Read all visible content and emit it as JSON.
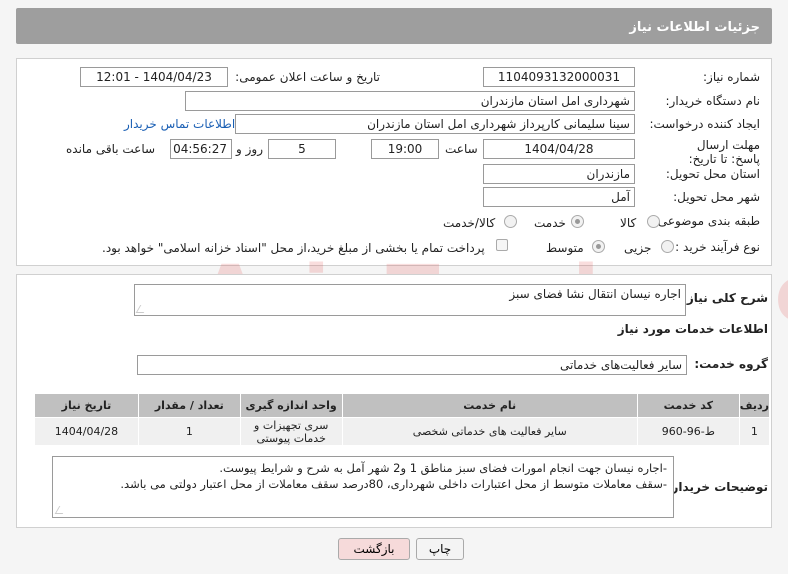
{
  "header": {
    "title": "جزئیات اطلاعات نیاز"
  },
  "watermark": {
    "brand": "AriaTender.neT"
  },
  "form": {
    "need_number": {
      "label": "شماره نیاز:",
      "value": "1104093132000031"
    },
    "announce": {
      "label": "تاریخ و ساعت اعلان عمومی:",
      "value": "1404/04/23 - 12:01"
    },
    "buyer_org": {
      "label": "نام دستگاه خریدار:",
      "value": "شهرداری امل استان مازندران"
    },
    "creator": {
      "label": "ایجاد کننده درخواست:",
      "value": "سینا سلیمانی کارپرداز شهرداری امل استان مازندران",
      "contact_link": "اطلاعات تماس خریدار"
    },
    "deadline": {
      "label": "مهلت ارسال پاسخ: تا تاریخ:",
      "date": "1404/04/28",
      "time_label": "ساعت",
      "time": "19:00",
      "days": "5",
      "days_label": "روز و",
      "remaining": "04:56:27",
      "remaining_label": "ساعت باقی مانده"
    },
    "province": {
      "label": "استان محل تحویل:",
      "value": "مازندران"
    },
    "city": {
      "label": "شهر محل تحویل:",
      "value": "آمل"
    },
    "category": {
      "label": "طبقه بندی موضوعی:",
      "options": [
        "کالا",
        "خدمت",
        "کالا/خدمت"
      ],
      "selected": "خدمت"
    },
    "purchase_type": {
      "label": "نوع فرآیند خرید :",
      "options": [
        "جزیی",
        "متوسط"
      ],
      "selected": "متوسط",
      "payment_note": "پرداخت تمام یا بخشی از مبلغ خرید،از محل \"اسناد خزانه اسلامی\" خواهد بود."
    }
  },
  "summary": {
    "label": "شرح کلی نیاز:",
    "value": "اجاره نیسان انتقال نشا فضای سبز"
  },
  "services": {
    "section_title": "اطلاعات خدمات مورد نیاز",
    "group_label": "گروه خدمت:",
    "group_value": "سایر فعالیت‌های خدماتی",
    "columns": [
      "ردیف",
      "کد خدمت",
      "نام خدمت",
      "واحد اندازه گیری",
      "تعداد / مقدار",
      "تاریخ نیاز"
    ],
    "rows": [
      {
        "row": "1",
        "code": "ط-96-960",
        "name": "سایر فعالیت های خدماتی شخصی",
        "unit": "سری تجهیزات و خدمات پیوستی",
        "qty": "1",
        "date": "1404/04/28"
      }
    ]
  },
  "buyer_notes": {
    "label": "توضیحات خریدار:",
    "line1": "-اجاره  نیسان جهت انجام امورات فضای سبز مناطق 1 و2 شهر آمل به شرح و شرایط پیوست.",
    "line2": "-سقف معاملات متوسط  از محل اعتبارات داخلی شهرداری، 80درصد سقف معاملات از محل اعتبار دولتی می باشد."
  },
  "buttons": {
    "print": "چاپ",
    "back": "بازگشت"
  }
}
